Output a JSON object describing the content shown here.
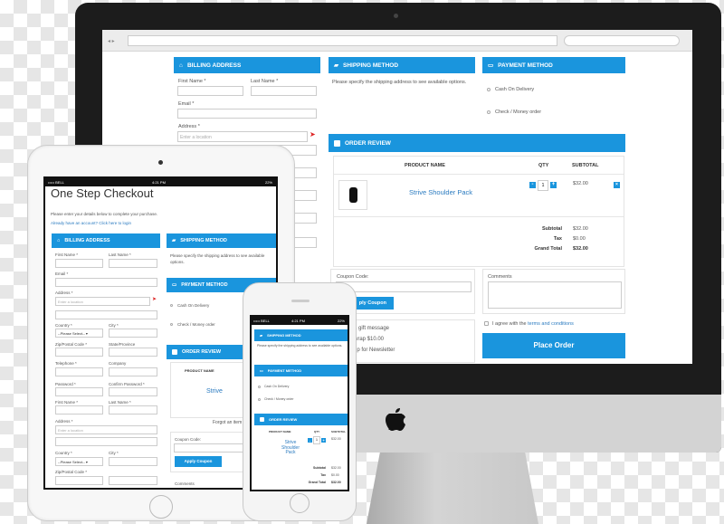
{
  "colors": {
    "accent": "#1a95dd",
    "bezel": "#1c1c1c",
    "link": "#2b7bc0"
  },
  "desktop": {
    "billing": {
      "title": "Billing Address",
      "first_name": "First Name *",
      "last_name": "Last Name *",
      "email": "Email *",
      "address": "Address *",
      "address_placeholder": "Enter a location"
    },
    "shipping": {
      "title": "Shipping Method",
      "text": "Please specify the shipping address to see available options."
    },
    "payment": {
      "title": "Payment Method",
      "options": [
        "Cash On Delivery",
        "Check / Money order"
      ]
    },
    "review": {
      "title": "Order Review",
      "col_product": "Product Name",
      "col_qty": "QTY",
      "col_subtotal": "Subtotal",
      "product": "Strive Shoulder Pack",
      "qty": "1",
      "price": "$32.00",
      "subtotal_label": "Subtotal",
      "subtotal": "$32.00",
      "tax_label": "Tax",
      "tax": "$0.00",
      "grand_label": "Grand Total",
      "grand": "$32.00"
    },
    "coupon_label": "Coupon Code:",
    "apply_coupon": "ply Coupon",
    "comments_label": "Comments",
    "gift": [
      "a gift message",
      "wrap $10.00",
      "up for Newsletter"
    ],
    "agree_prefix": "I agree with the ",
    "agree_link": "terms and conditions",
    "place_order": "Place Order"
  },
  "tablet": {
    "status": {
      "carrier": "••••• BELL",
      "time": "4:21 PM",
      "battery": "22%"
    },
    "title": "One Step Checkout",
    "intro": "Please enter your details below to complete your purchase.",
    "login_link": "Already have an account? Click here to login",
    "billing": {
      "title": "Billing Address",
      "first_name": "First Name *",
      "last_name": "Last Name *",
      "email": "Email *",
      "address": "Address *",
      "placeholder": "Enter a location",
      "country": "Country *",
      "city": "City *",
      "select": "--Please Select--",
      "zip": "Zip/Postal Code *",
      "state": "State/Province",
      "telephone": "Telephone *",
      "company": "Company",
      "password": "Password *",
      "confirm": "Confirm Password *"
    },
    "shipping": {
      "title": "Shipping Method",
      "text": "Please specify the shipping address to see available options."
    },
    "payment": {
      "title": "Payment Method",
      "options": [
        "Cash On Delivery",
        "Check / Money order"
      ]
    },
    "review": {
      "title": "Order Review",
      "col_product": "Product Name",
      "product": "Strive",
      "forgot": "Forgot an item"
    },
    "coupon_label": "Coupon Code:",
    "apply_coupon": "Apply Coupon",
    "comments_label": "Comments"
  },
  "phone": {
    "status": {
      "carrier": "••••• BELL",
      "time": "4:21 PM",
      "battery": "22%"
    },
    "shipping": {
      "title": "Shipping Method",
      "text": "Please specify the shipping address to see available options."
    },
    "payment": {
      "title": "Payment Method",
      "options": [
        "Cash On Delivery",
        "Check / Money order"
      ]
    },
    "review": {
      "title": "Order Review",
      "col_product": "Product Name",
      "col_qty": "QTY",
      "col_subtotal": "Subtotal",
      "product": "Strive Shoulder Pack",
      "qty": "1",
      "price": "$32.00",
      "subtotal_label": "Subtotal",
      "subtotal": "$32.00",
      "tax_label": "Tax",
      "tax": "$0.00",
      "grand_label": "Grand Total",
      "grand": "$32.00"
    }
  }
}
